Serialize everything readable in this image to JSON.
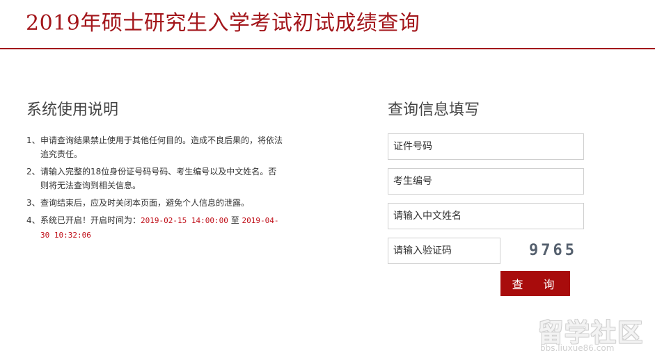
{
  "header": {
    "title": "2019年硕士研究生入学考试初试成绩查询",
    "accent_color": "#a3161b"
  },
  "instructions": {
    "heading": "系统使用说明",
    "items": [
      {
        "num": "1、",
        "text": "申请查询结果禁止使用于其他任何目的。造成不良后果的，将依法追究责任。"
      },
      {
        "num": "2、",
        "text": "请输入完整的18位身份证号码号码、考生编号以及中文姓名。否则将无法查询到相关信息。"
      },
      {
        "num": "3、",
        "text": "查询结束后，应及时关闭本页面，避免个人信息的泄露。"
      },
      {
        "num": "4、",
        "text": "系统已开启！开启时间为：",
        "start_time": "2019-02-15 14:00:00",
        "connector": "至",
        "end_time": "2019-04-30 10:32:06"
      }
    ]
  },
  "query": {
    "heading": "查询信息填写",
    "id_placeholder": "证件号码",
    "exam_no_placeholder": "考生编号",
    "name_placeholder": "请输入中文姓名",
    "captcha_placeholder": "请输入验证码",
    "captcha_text": "9765",
    "submit_label": "查 询",
    "button_color": "#a80c0c"
  },
  "watermark": {
    "logo_text": "留学社区",
    "url": "bbs.liuxue86.com"
  }
}
